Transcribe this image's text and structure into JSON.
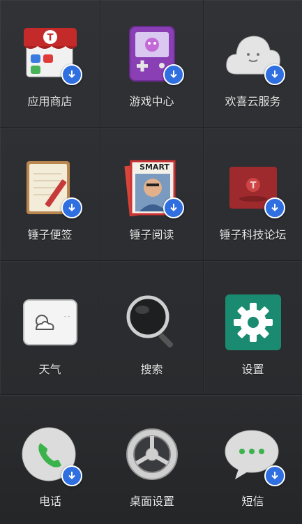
{
  "apps": [
    {
      "label": "应用商店",
      "icon": "app-store-icon",
      "download": true
    },
    {
      "label": "游戏中心",
      "icon": "game-center-icon",
      "download": true
    },
    {
      "label": "欢喜云服务",
      "icon": "cloud-service-icon",
      "download": true
    },
    {
      "label": "锤子便签",
      "icon": "notes-icon",
      "download": true
    },
    {
      "label": "锤子阅读",
      "icon": "reader-icon",
      "download": true
    },
    {
      "label": "锤子科技论坛",
      "icon": "forum-icon",
      "download": true
    },
    {
      "label": "天气",
      "icon": "weather-icon",
      "download": false
    },
    {
      "label": "搜索",
      "icon": "search-icon",
      "download": false
    },
    {
      "label": "设置",
      "icon": "settings-icon",
      "download": false
    }
  ],
  "dock": [
    {
      "label": "电话",
      "icon": "phone-icon",
      "download": true
    },
    {
      "label": "桌面设置",
      "icon": "desktop-settings-icon",
      "download": false
    },
    {
      "label": "短信",
      "icon": "sms-icon",
      "download": true
    }
  ],
  "reader_cover_text": "SMART",
  "colors": {
    "badge": "#2f6fe0",
    "settings_green": "#1a8a70",
    "phone_green": "#3bb34a"
  }
}
